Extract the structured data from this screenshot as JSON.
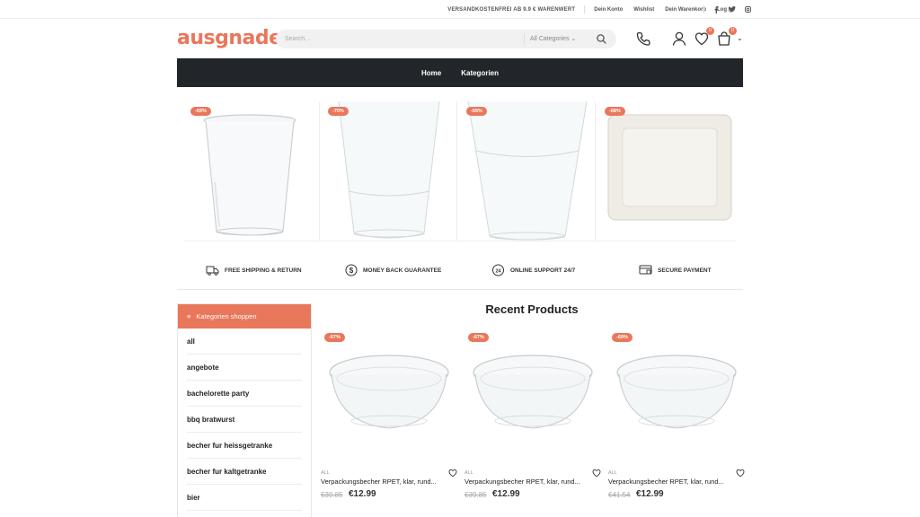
{
  "topbar": {
    "promo": "VERSANDKOSTENFREI AB 9.9 € WARENWERT",
    "links": [
      "Dein Konto",
      "Wishlist",
      "Dein Warenkorb",
      "Log In"
    ],
    "social": [
      "f",
      "t",
      "ig"
    ]
  },
  "header": {
    "logo": "ausgnade",
    "search_placeholder": "Search...",
    "category_select": "All Categories",
    "wishlist_count": "0",
    "cart_count": "0"
  },
  "nav": {
    "items": [
      "Home",
      "Kategorien"
    ]
  },
  "hero": {
    "tiles": [
      {
        "badge": "-69%"
      },
      {
        "badge": "-70%"
      },
      {
        "badge": "-69%"
      },
      {
        "badge": "-68%"
      }
    ]
  },
  "features": [
    {
      "icon": "truck-icon",
      "label": "FREE SHIPPING & RETURN"
    },
    {
      "icon": "dollar-icon",
      "label": "MONEY BACK GUARANTEE"
    },
    {
      "icon": "support-24-icon",
      "label": "ONLINE SUPPORT 24/7"
    },
    {
      "icon": "secure-payment-icon",
      "label": "SECURE PAYMENT"
    }
  ],
  "sidebar": {
    "title": "Kategorien shoppen",
    "items": [
      "all",
      "angebote",
      "bachelorette party",
      "bbq bratwurst",
      "becher fur heissgetranke",
      "becher fur kaltgetranke",
      "bier"
    ]
  },
  "recent": {
    "title": "Recent Products",
    "products": [
      {
        "badge": "-67%",
        "category": "ALL",
        "name": "Verpackungsbecher RPET, klar, rund...",
        "old_price": "€39.85",
        "price": "€12.99"
      },
      {
        "badge": "-67%",
        "category": "ALL",
        "name": "Verpackungsbecher RPET, klar, rund...",
        "old_price": "€39.85",
        "price": "€12.99"
      },
      {
        "badge": "-69%",
        "category": "ALL",
        "name": "Verpackungsbecher RPET, klar, rund...",
        "old_price": "€41.54",
        "price": "€12.99"
      }
    ]
  },
  "colors": {
    "accent": "#e8775b",
    "nav_bg": "#222529"
  }
}
